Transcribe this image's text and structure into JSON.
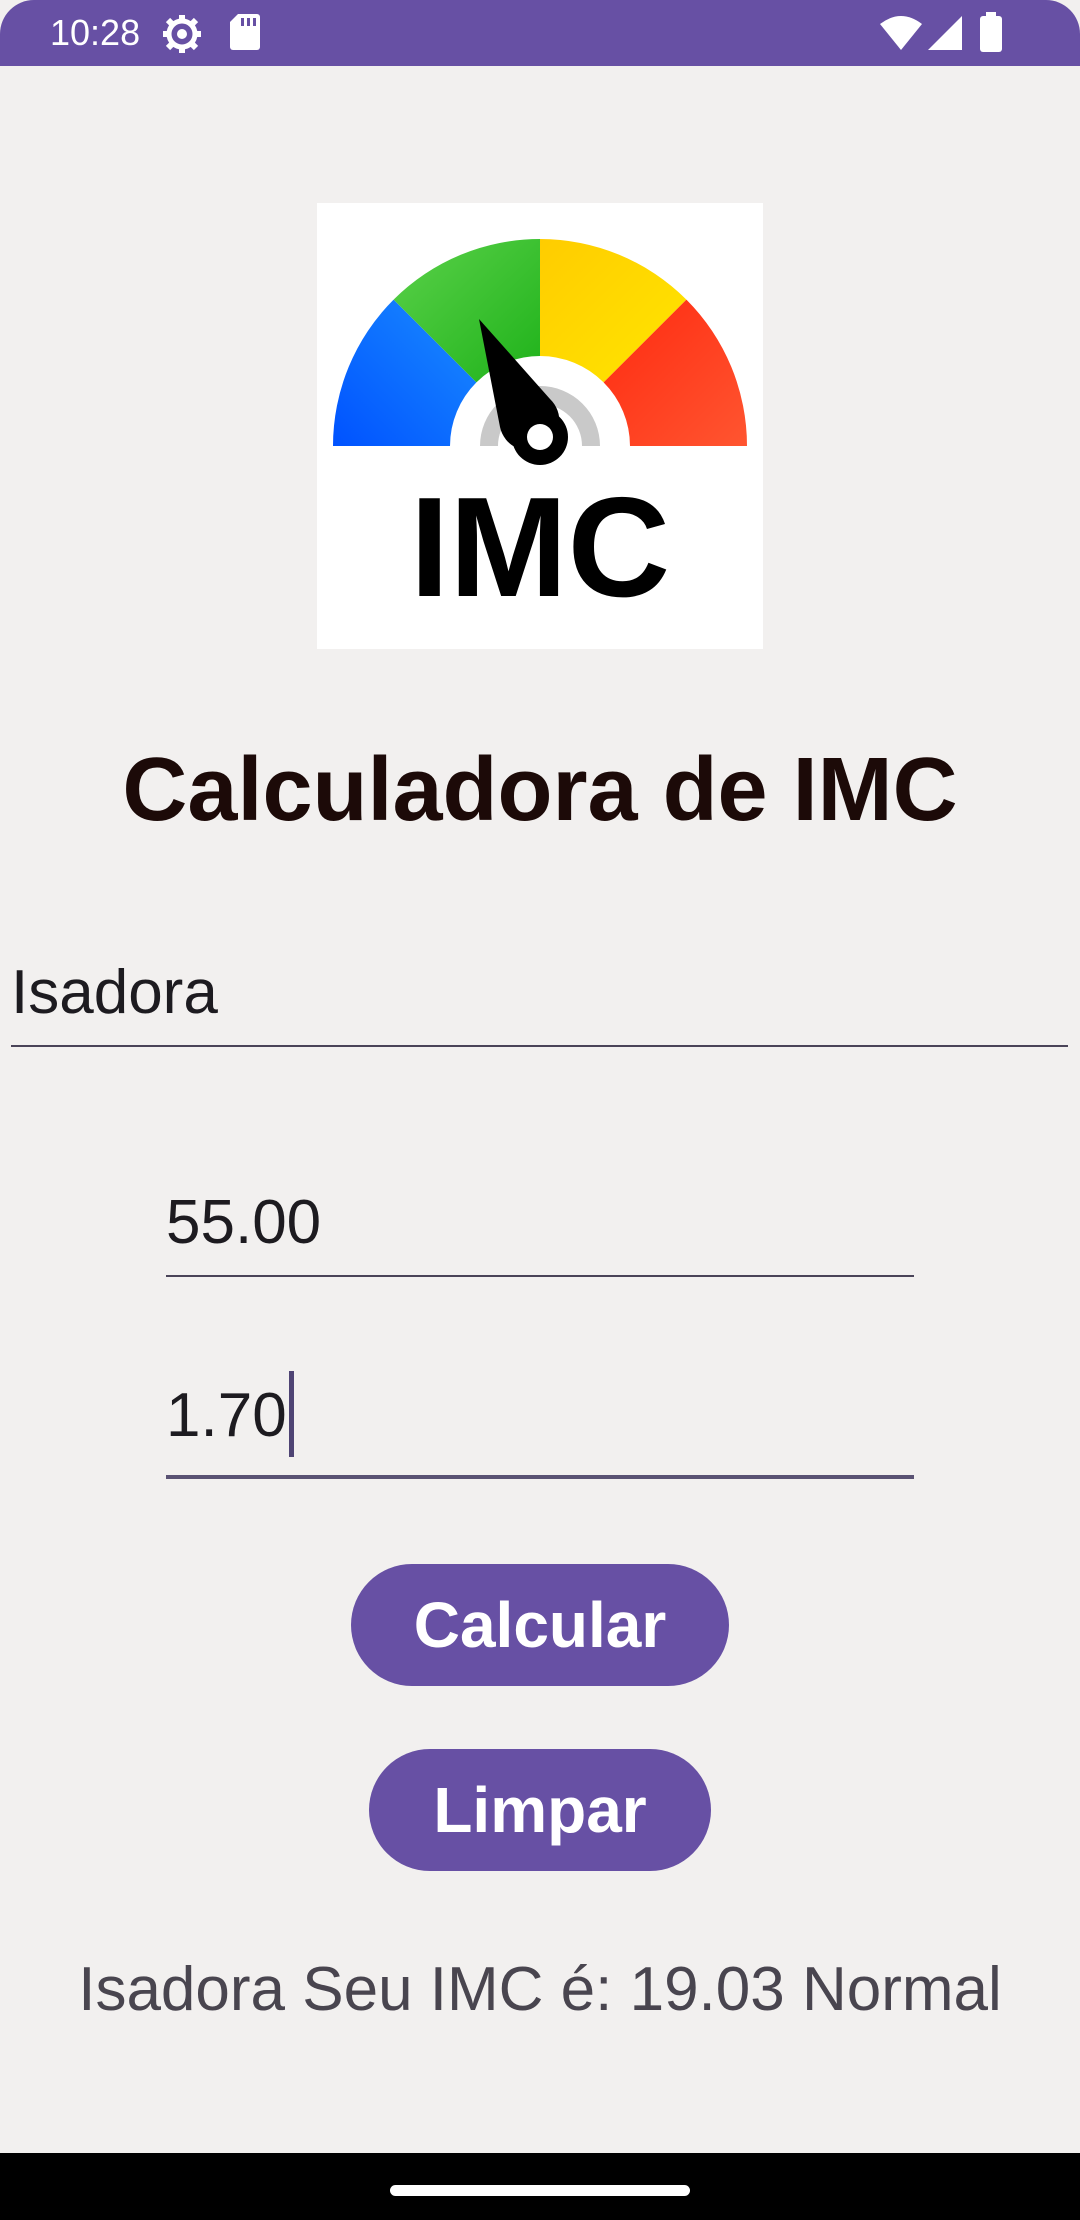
{
  "status_bar": {
    "time": "10:28",
    "icons": [
      "settings-gear-icon",
      "sd-card-icon",
      "wifi-icon",
      "cellular-signal-icon",
      "battery-icon"
    ],
    "color": "#6750a4"
  },
  "logo": {
    "text": "IMC",
    "icon": "gauge-meter-icon",
    "colors": [
      "#0066ff",
      "#3ac12f",
      "#ffd400",
      "#ff4418"
    ]
  },
  "header": {
    "title": "Calculadora de IMC"
  },
  "form": {
    "name_value": "Isadora",
    "weight_value": "55.00",
    "height_value": "1.70"
  },
  "buttons": {
    "calculate_label": "Calcular",
    "clear_label": "Limpar",
    "color": "#6750a4"
  },
  "result": {
    "text": "Isadora Seu IMC é: 19.03 Normal"
  }
}
